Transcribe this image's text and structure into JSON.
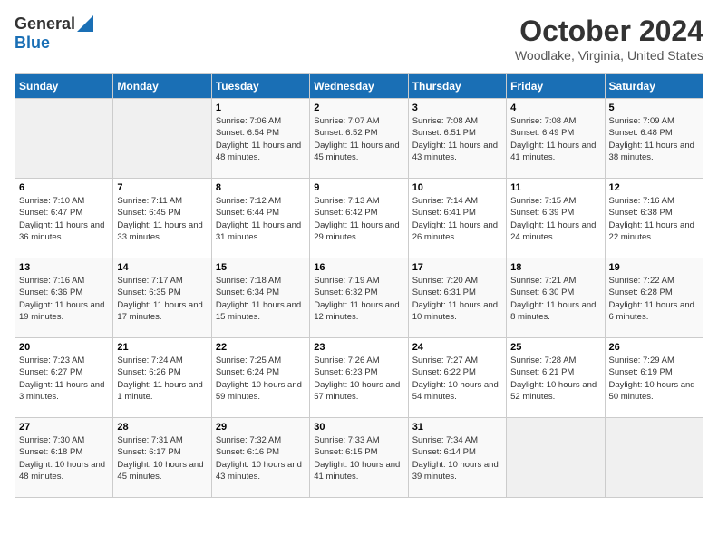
{
  "header": {
    "logo_general": "General",
    "logo_blue": "Blue",
    "month_title": "October 2024",
    "location": "Woodlake, Virginia, United States"
  },
  "days_of_week": [
    "Sunday",
    "Monday",
    "Tuesday",
    "Wednesday",
    "Thursday",
    "Friday",
    "Saturday"
  ],
  "weeks": [
    [
      {
        "day": "",
        "sunrise": "",
        "sunset": "",
        "daylight": ""
      },
      {
        "day": "",
        "sunrise": "",
        "sunset": "",
        "daylight": ""
      },
      {
        "day": "1",
        "sunrise": "Sunrise: 7:06 AM",
        "sunset": "Sunset: 6:54 PM",
        "daylight": "Daylight: 11 hours and 48 minutes."
      },
      {
        "day": "2",
        "sunrise": "Sunrise: 7:07 AM",
        "sunset": "Sunset: 6:52 PM",
        "daylight": "Daylight: 11 hours and 45 minutes."
      },
      {
        "day": "3",
        "sunrise": "Sunrise: 7:08 AM",
        "sunset": "Sunset: 6:51 PM",
        "daylight": "Daylight: 11 hours and 43 minutes."
      },
      {
        "day": "4",
        "sunrise": "Sunrise: 7:08 AM",
        "sunset": "Sunset: 6:49 PM",
        "daylight": "Daylight: 11 hours and 41 minutes."
      },
      {
        "day": "5",
        "sunrise": "Sunrise: 7:09 AM",
        "sunset": "Sunset: 6:48 PM",
        "daylight": "Daylight: 11 hours and 38 minutes."
      }
    ],
    [
      {
        "day": "6",
        "sunrise": "Sunrise: 7:10 AM",
        "sunset": "Sunset: 6:47 PM",
        "daylight": "Daylight: 11 hours and 36 minutes."
      },
      {
        "day": "7",
        "sunrise": "Sunrise: 7:11 AM",
        "sunset": "Sunset: 6:45 PM",
        "daylight": "Daylight: 11 hours and 33 minutes."
      },
      {
        "day": "8",
        "sunrise": "Sunrise: 7:12 AM",
        "sunset": "Sunset: 6:44 PM",
        "daylight": "Daylight: 11 hours and 31 minutes."
      },
      {
        "day": "9",
        "sunrise": "Sunrise: 7:13 AM",
        "sunset": "Sunset: 6:42 PM",
        "daylight": "Daylight: 11 hours and 29 minutes."
      },
      {
        "day": "10",
        "sunrise": "Sunrise: 7:14 AM",
        "sunset": "Sunset: 6:41 PM",
        "daylight": "Daylight: 11 hours and 26 minutes."
      },
      {
        "day": "11",
        "sunrise": "Sunrise: 7:15 AM",
        "sunset": "Sunset: 6:39 PM",
        "daylight": "Daylight: 11 hours and 24 minutes."
      },
      {
        "day": "12",
        "sunrise": "Sunrise: 7:16 AM",
        "sunset": "Sunset: 6:38 PM",
        "daylight": "Daylight: 11 hours and 22 minutes."
      }
    ],
    [
      {
        "day": "13",
        "sunrise": "Sunrise: 7:16 AM",
        "sunset": "Sunset: 6:36 PM",
        "daylight": "Daylight: 11 hours and 19 minutes."
      },
      {
        "day": "14",
        "sunrise": "Sunrise: 7:17 AM",
        "sunset": "Sunset: 6:35 PM",
        "daylight": "Daylight: 11 hours and 17 minutes."
      },
      {
        "day": "15",
        "sunrise": "Sunrise: 7:18 AM",
        "sunset": "Sunset: 6:34 PM",
        "daylight": "Daylight: 11 hours and 15 minutes."
      },
      {
        "day": "16",
        "sunrise": "Sunrise: 7:19 AM",
        "sunset": "Sunset: 6:32 PM",
        "daylight": "Daylight: 11 hours and 12 minutes."
      },
      {
        "day": "17",
        "sunrise": "Sunrise: 7:20 AM",
        "sunset": "Sunset: 6:31 PM",
        "daylight": "Daylight: 11 hours and 10 minutes."
      },
      {
        "day": "18",
        "sunrise": "Sunrise: 7:21 AM",
        "sunset": "Sunset: 6:30 PM",
        "daylight": "Daylight: 11 hours and 8 minutes."
      },
      {
        "day": "19",
        "sunrise": "Sunrise: 7:22 AM",
        "sunset": "Sunset: 6:28 PM",
        "daylight": "Daylight: 11 hours and 6 minutes."
      }
    ],
    [
      {
        "day": "20",
        "sunrise": "Sunrise: 7:23 AM",
        "sunset": "Sunset: 6:27 PM",
        "daylight": "Daylight: 11 hours and 3 minutes."
      },
      {
        "day": "21",
        "sunrise": "Sunrise: 7:24 AM",
        "sunset": "Sunset: 6:26 PM",
        "daylight": "Daylight: 11 hours and 1 minute."
      },
      {
        "day": "22",
        "sunrise": "Sunrise: 7:25 AM",
        "sunset": "Sunset: 6:24 PM",
        "daylight": "Daylight: 10 hours and 59 minutes."
      },
      {
        "day": "23",
        "sunrise": "Sunrise: 7:26 AM",
        "sunset": "Sunset: 6:23 PM",
        "daylight": "Daylight: 10 hours and 57 minutes."
      },
      {
        "day": "24",
        "sunrise": "Sunrise: 7:27 AM",
        "sunset": "Sunset: 6:22 PM",
        "daylight": "Daylight: 10 hours and 54 minutes."
      },
      {
        "day": "25",
        "sunrise": "Sunrise: 7:28 AM",
        "sunset": "Sunset: 6:21 PM",
        "daylight": "Daylight: 10 hours and 52 minutes."
      },
      {
        "day": "26",
        "sunrise": "Sunrise: 7:29 AM",
        "sunset": "Sunset: 6:19 PM",
        "daylight": "Daylight: 10 hours and 50 minutes."
      }
    ],
    [
      {
        "day": "27",
        "sunrise": "Sunrise: 7:30 AM",
        "sunset": "Sunset: 6:18 PM",
        "daylight": "Daylight: 10 hours and 48 minutes."
      },
      {
        "day": "28",
        "sunrise": "Sunrise: 7:31 AM",
        "sunset": "Sunset: 6:17 PM",
        "daylight": "Daylight: 10 hours and 45 minutes."
      },
      {
        "day": "29",
        "sunrise": "Sunrise: 7:32 AM",
        "sunset": "Sunset: 6:16 PM",
        "daylight": "Daylight: 10 hours and 43 minutes."
      },
      {
        "day": "30",
        "sunrise": "Sunrise: 7:33 AM",
        "sunset": "Sunset: 6:15 PM",
        "daylight": "Daylight: 10 hours and 41 minutes."
      },
      {
        "day": "31",
        "sunrise": "Sunrise: 7:34 AM",
        "sunset": "Sunset: 6:14 PM",
        "daylight": "Daylight: 10 hours and 39 minutes."
      },
      {
        "day": "",
        "sunrise": "",
        "sunset": "",
        "daylight": ""
      },
      {
        "day": "",
        "sunrise": "",
        "sunset": "",
        "daylight": ""
      }
    ]
  ]
}
